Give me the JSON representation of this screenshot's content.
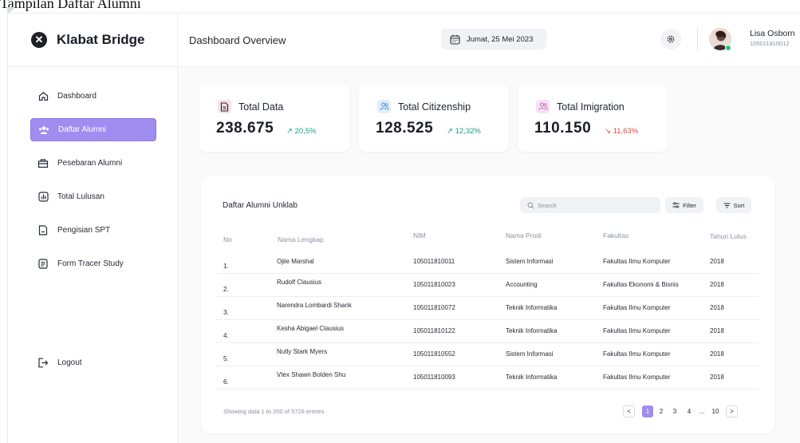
{
  "caption": "Tampilan Daftar Alumni",
  "colors": {
    "accent": "#9f8df0",
    "up": "#16a085",
    "down": "#e74c3c"
  },
  "brand": {
    "name": "Klabat Bridge",
    "icon": "close-circle-icon"
  },
  "sidebar": {
    "items": [
      {
        "label": "Dashboard",
        "icon": "home-icon",
        "active": false
      },
      {
        "label": "Daftar Alumni",
        "icon": "users-icon",
        "active": true
      },
      {
        "label": "Pesebaran Alumni",
        "icon": "map-icon",
        "active": false
      },
      {
        "label": "Total Lulusan",
        "icon": "bar-chart-icon",
        "active": false
      },
      {
        "label": "Pengisian SPT",
        "icon": "document-icon",
        "active": false
      },
      {
        "label": "Form Tracer Study",
        "icon": "form-icon",
        "active": false
      }
    ],
    "logout": "Logout"
  },
  "header": {
    "title": "Dashboard Overview",
    "date": "Jumat, 25 Mei 2023",
    "user": {
      "name": "Lisa Osborn",
      "id": "105011810012"
    }
  },
  "stats": [
    {
      "title": "Total Data",
      "value": "238.675",
      "change": "20,5%",
      "trend": "up"
    },
    {
      "title": "Total Citizenship",
      "value": "128.525",
      "change": "12,32%",
      "trend": "up"
    },
    {
      "title": "Total Imigration",
      "value": "110.150",
      "change": "11,63%",
      "trend": "down"
    }
  ],
  "table": {
    "title": "Daftar Alumni Unklab",
    "search_placeholder": "Search",
    "filter_label": "Filter",
    "sort_label": "Sort",
    "columns": [
      "No",
      "Nama Lengkap",
      "NIM",
      "Nama Prodi",
      "Fakultas",
      "Tahun Lulus"
    ],
    "rows": [
      [
        "1.",
        "Ojiie Marshal",
        "105011810011",
        "Sistem Informasi",
        "Fakultas Ilmu Komputer",
        "2018"
      ],
      [
        "2.",
        "Rudolf Clausius",
        "105011810023",
        "Accounting",
        "Fakultas Ekonomi & Bisnis",
        "2018"
      ],
      [
        "3.",
        "Narendra Lombardi Shank",
        "105011810072",
        "Teknik Informatika",
        "Fakultas Ilmu Komputer",
        "2018"
      ],
      [
        "4.",
        "Kesha Abigael Clausius",
        "105011810122",
        "Teknik Informatika",
        "Fakultas Ilmu Komputer",
        "2018"
      ],
      [
        "5.",
        "Nutly Stark Myers",
        "105011810552",
        "Sistem Informasi",
        "Fakultas Ilmu Komputer",
        "2018"
      ],
      [
        "6.",
        "Vtex Shawn Bolden Shu",
        "105011810093",
        "Teknik Informatika",
        "Fakultas Ilmu Komputer",
        "2018"
      ]
    ],
    "footer": "Showing data 1 to 200 of 5728 entries",
    "pagination": {
      "prev": "<",
      "pages": [
        "1",
        "2",
        "3",
        "4",
        "...",
        "10"
      ],
      "active": "1",
      "next": ">"
    }
  }
}
